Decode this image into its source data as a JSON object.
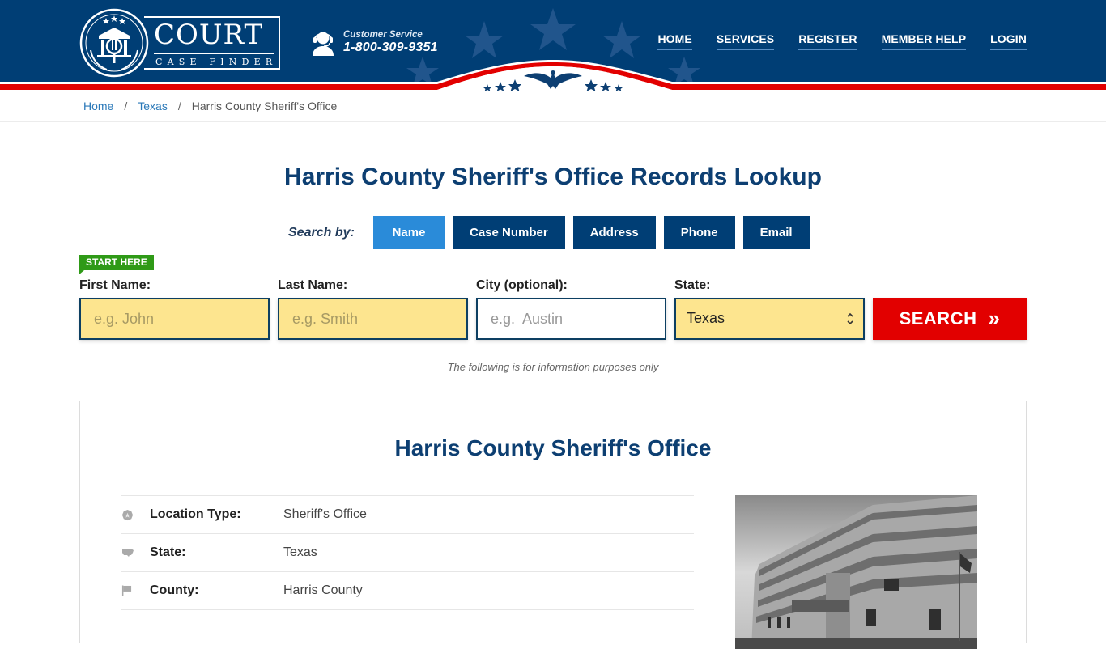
{
  "header": {
    "logo": {
      "title": "COURT",
      "subtitle": "CASE FINDER"
    },
    "customer_service": {
      "label": "Customer Service",
      "phone": "1-800-309-9351",
      "icon": "headset-agent-icon"
    },
    "nav": [
      {
        "label": "HOME"
      },
      {
        "label": "SERVICES"
      },
      {
        "label": "REGISTER"
      },
      {
        "label": "MEMBER HELP"
      },
      {
        "label": "LOGIN"
      }
    ],
    "colors": {
      "primary": "#003e75",
      "accent_red": "#e20000"
    }
  },
  "breadcrumb": {
    "items": [
      {
        "label": "Home",
        "link": true
      },
      {
        "label": "Texas",
        "link": true
      },
      {
        "label": "Harris County Sheriff's Office",
        "link": false
      }
    ],
    "separator": "/"
  },
  "main": {
    "title": "Harris County Sheriff's Office Records Lookup",
    "search_by_label": "Search by:",
    "tabs": [
      {
        "label": "Name",
        "active": true
      },
      {
        "label": "Case Number",
        "active": false
      },
      {
        "label": "Address",
        "active": false
      },
      {
        "label": "Phone",
        "active": false
      },
      {
        "label": "Email",
        "active": false
      }
    ],
    "start_here": "START HERE",
    "fields": {
      "first_name": {
        "label": "First Name:",
        "placeholder": "e.g. John",
        "value": ""
      },
      "last_name": {
        "label": "Last Name:",
        "placeholder": "e.g. Smith",
        "value": ""
      },
      "city": {
        "label": "City (optional):",
        "placeholder": "e.g.  Austin",
        "value": ""
      },
      "state": {
        "label": "State:",
        "selected": "Texas"
      }
    },
    "search_button": {
      "label": "SEARCH",
      "icon": "»"
    },
    "disclaimer": "The following is for information purposes only"
  },
  "info_card": {
    "title": "Harris County Sheriff's Office",
    "rows": [
      {
        "icon": "badge-icon",
        "label": "Location Type:",
        "value": "Sheriff's Office"
      },
      {
        "icon": "us-map-icon",
        "label": "State:",
        "value": "Texas"
      },
      {
        "icon": "flag-icon",
        "label": "County:",
        "value": "Harris County"
      }
    ],
    "photo_alt": "Harris County Sheriff's Office building"
  }
}
